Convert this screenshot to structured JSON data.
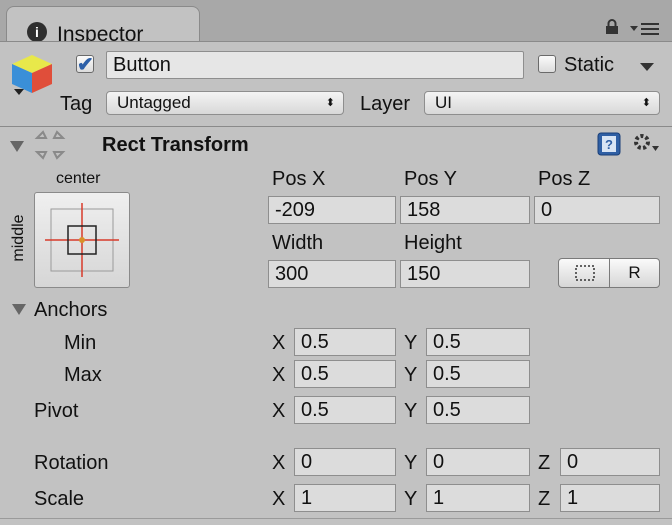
{
  "tab": {
    "title": "Inspector"
  },
  "header": {
    "active": true,
    "name": "Button",
    "static_label": "Static",
    "tag_label": "Tag",
    "tag_value": "Untagged",
    "layer_label": "Layer",
    "layer_value": "UI"
  },
  "rect_transform": {
    "title": "Rect Transform",
    "anchor_preset_h": "center",
    "anchor_preset_v": "middle",
    "pos_x_label": "Pos X",
    "pos_y_label": "Pos Y",
    "pos_z_label": "Pos Z",
    "pos_x": "-209",
    "pos_y": "158",
    "pos_z": "0",
    "width_label": "Width",
    "height_label": "Height",
    "width": "300",
    "height": "150",
    "raw_edit_label": "R",
    "anchors_label": "Anchors",
    "min_label": "Min",
    "max_label": "Max",
    "anchor_min": {
      "x": "0.5",
      "y": "0.5"
    },
    "anchor_max": {
      "x": "0.5",
      "y": "0.5"
    },
    "pivot_label": "Pivot",
    "pivot": {
      "x": "0.5",
      "y": "0.5"
    },
    "rotation_label": "Rotation",
    "rotation": {
      "x": "0",
      "y": "0",
      "z": "0"
    },
    "scale_label": "Scale",
    "scale": {
      "x": "1",
      "y": "1",
      "z": "1"
    },
    "axis_x": "X",
    "axis_y": "Y",
    "axis_z": "Z"
  },
  "icons": [
    "info-icon",
    "lock-icon",
    "menu-icon",
    "gameobject-icon",
    "checkbox-icon",
    "rect-transform-icon",
    "help-icon",
    "gear-icon",
    "blueprint-icon"
  ]
}
